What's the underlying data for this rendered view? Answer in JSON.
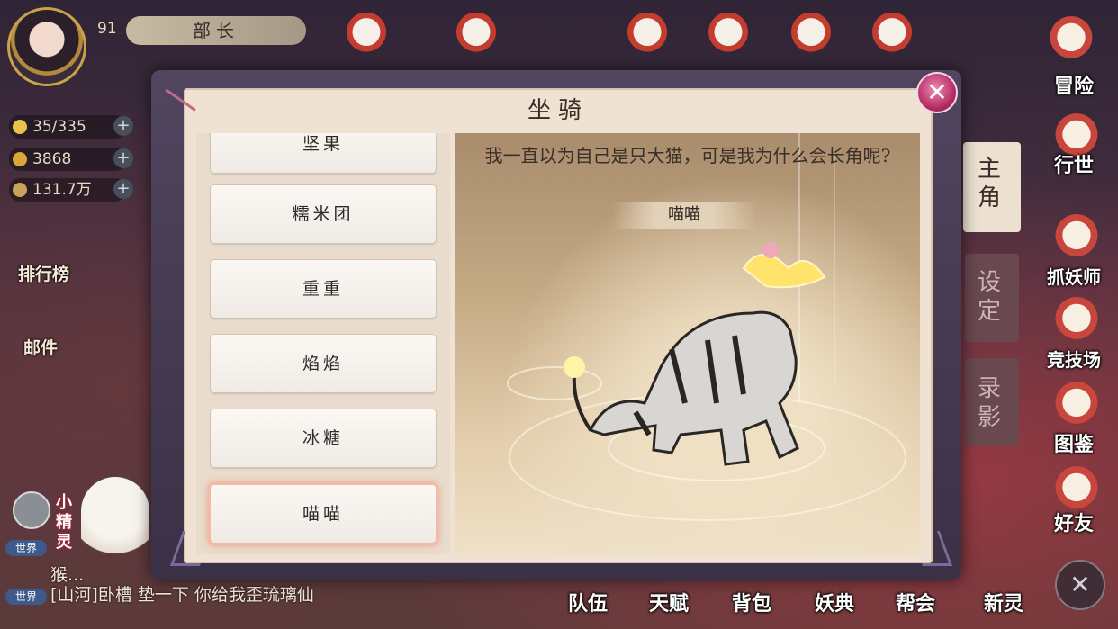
{
  "player": {
    "level": "91",
    "rank": "部长",
    "stamina": "35/335",
    "gold": "3868",
    "silver": "131.7万"
  },
  "top_icons": [
    "icon-1",
    "icon-2",
    "icon-3",
    "icon-4",
    "icon-5",
    "icon-6"
  ],
  "left_menu": {
    "ranking": "排行榜",
    "mail": "邮件"
  },
  "right_menu": {
    "adventure": "冒险",
    "team_battle": "行世",
    "demon_master": "抓妖师",
    "arena": "竞技场",
    "atlas": "图鉴",
    "friends": "好友",
    "new_spirit": "新灵"
  },
  "side_tabs": {
    "protagonist": "主角",
    "settings": "设定",
    "record": "录影"
  },
  "bottom_menu": [
    "队伍",
    "天赋",
    "背包",
    "妖典",
    "帮会"
  ],
  "chat": {
    "channel1": "世界",
    "line1": "猴...",
    "channel2": "世界",
    "line2": "[山河]卧槽 垫一下 你给我歪琉璃仙",
    "sprite_label": "小精灵"
  },
  "dialog": {
    "title": "坐骑",
    "close_label": "✕",
    "items": [
      "坚果",
      "糯米团",
      "重重",
      "焰焰",
      "冰糖",
      "喵喵"
    ],
    "selected": "喵喵",
    "description": "我一直以为自己是只大猫，可是我为什么会长角呢?",
    "mount_name": "喵喵"
  },
  "colors": {
    "frame": "#f0e2d2",
    "accent": "#b02a62",
    "selected_glow": "#f4b9a8"
  }
}
